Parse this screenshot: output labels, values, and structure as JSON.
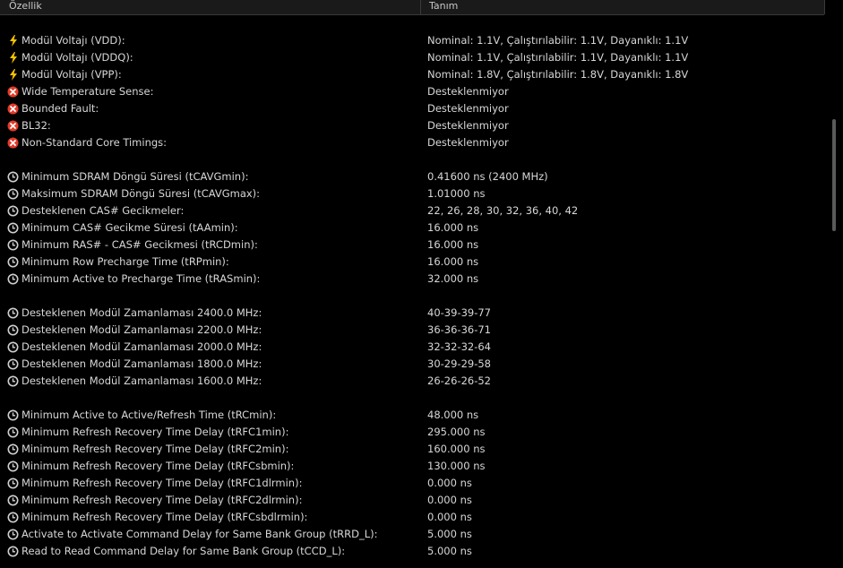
{
  "columns": {
    "property": "Özellik",
    "value": "Tanım"
  },
  "colors": {
    "background": "#000000",
    "text": "#d7d7d7",
    "header_bg": "#1a1a1a",
    "bolt": "#f5c400",
    "error": "#e23b2a",
    "clock": "#cfcfcf"
  },
  "rows": [
    {
      "icon": "",
      "label": "",
      "value": ""
    },
    {
      "icon": "bolt-icon",
      "label": "Modül Voltajı (VDD):",
      "value": "Nominal: 1.1V, Çalıştırılabilir: 1.1V, Dayanıklı: 1.1V"
    },
    {
      "icon": "bolt-icon",
      "label": "Modül Voltajı (VDDQ):",
      "value": "Nominal: 1.1V, Çalıştırılabilir: 1.1V, Dayanıklı: 1.1V"
    },
    {
      "icon": "bolt-icon",
      "label": "Modül Voltajı (VPP):",
      "value": "Nominal: 1.8V, Çalıştırılabilir: 1.8V, Dayanıklı: 1.8V"
    },
    {
      "icon": "error-icon",
      "label": "Wide Temperature Sense:",
      "value": "Desteklenmiyor"
    },
    {
      "icon": "error-icon",
      "label": "Bounded Fault:",
      "value": "Desteklenmiyor"
    },
    {
      "icon": "error-icon",
      "label": "BL32:",
      "value": "Desteklenmiyor"
    },
    {
      "icon": "error-icon",
      "label": "Non-Standard Core Timings:",
      "value": "Desteklenmiyor"
    },
    {
      "icon": "",
      "label": "",
      "value": ""
    },
    {
      "icon": "clock-icon",
      "label": "Minimum SDRAM Döngü Süresi (tCAVGmin):",
      "value": "0.41600 ns (2400 MHz)"
    },
    {
      "icon": "clock-icon",
      "label": "Maksimum SDRAM Döngü Süresi (tCAVGmax):",
      "value": "1.01000 ns"
    },
    {
      "icon": "clock-icon",
      "label": "Desteklenen CAS# Gecikmeler:",
      "value": "22, 26, 28, 30, 32, 36, 40, 42"
    },
    {
      "icon": "clock-icon",
      "label": "Minimum CAS# Gecikme Süresi (tAAmin):",
      "value": "16.000 ns"
    },
    {
      "icon": "clock-icon",
      "label": "Minimum RAS# - CAS# Gecikmesi (tRCDmin):",
      "value": "16.000 ns"
    },
    {
      "icon": "clock-icon",
      "label": "Minimum Row Precharge Time (tRPmin):",
      "value": "16.000 ns"
    },
    {
      "icon": "clock-icon",
      "label": "Minimum Active to Precharge Time (tRASmin):",
      "value": "32.000 ns"
    },
    {
      "icon": "",
      "label": "",
      "value": ""
    },
    {
      "icon": "clock-icon",
      "label": "Desteklenen Modül Zamanlaması 2400.0 MHz:",
      "value": "40-39-39-77"
    },
    {
      "icon": "clock-icon",
      "label": "Desteklenen Modül Zamanlaması 2200.0 MHz:",
      "value": "36-36-36-71"
    },
    {
      "icon": "clock-icon",
      "label": "Desteklenen Modül Zamanlaması 2000.0 MHz:",
      "value": "32-32-32-64"
    },
    {
      "icon": "clock-icon",
      "label": "Desteklenen Modül Zamanlaması 1800.0 MHz:",
      "value": "30-29-29-58"
    },
    {
      "icon": "clock-icon",
      "label": "Desteklenen Modül Zamanlaması 1600.0 MHz:",
      "value": "26-26-26-52"
    },
    {
      "icon": "",
      "label": "",
      "value": ""
    },
    {
      "icon": "clock-icon",
      "label": "Minimum Active to Active/Refresh Time (tRCmin):",
      "value": "48.000 ns"
    },
    {
      "icon": "clock-icon",
      "label": "Minimum Refresh Recovery Time Delay (tRFC1min):",
      "value": "295.000 ns"
    },
    {
      "icon": "clock-icon",
      "label": "Minimum Refresh Recovery Time Delay (tRFC2min):",
      "value": "160.000 ns"
    },
    {
      "icon": "clock-icon",
      "label": "Minimum Refresh Recovery Time Delay (tRFCsbmin):",
      "value": "130.000 ns"
    },
    {
      "icon": "clock-icon",
      "label": "Minimum Refresh Recovery Time Delay (tRFC1dlrmin):",
      "value": "0.000 ns"
    },
    {
      "icon": "clock-icon",
      "label": "Minimum Refresh Recovery Time Delay (tRFC2dlrmin):",
      "value": "0.000 ns"
    },
    {
      "icon": "clock-icon",
      "label": "Minimum Refresh Recovery Time Delay (tRFCsbdlrmin):",
      "value": "0.000 ns"
    },
    {
      "icon": "clock-icon",
      "label": "Activate to Activate Command Delay for Same Bank Group (tRRD_L):",
      "value": "5.000 ns"
    },
    {
      "icon": "clock-icon",
      "label": "Read to Read Command Delay for Same Bank Group (tCCD_L):",
      "value": "5.000 ns"
    }
  ],
  "status_text": "..."
}
